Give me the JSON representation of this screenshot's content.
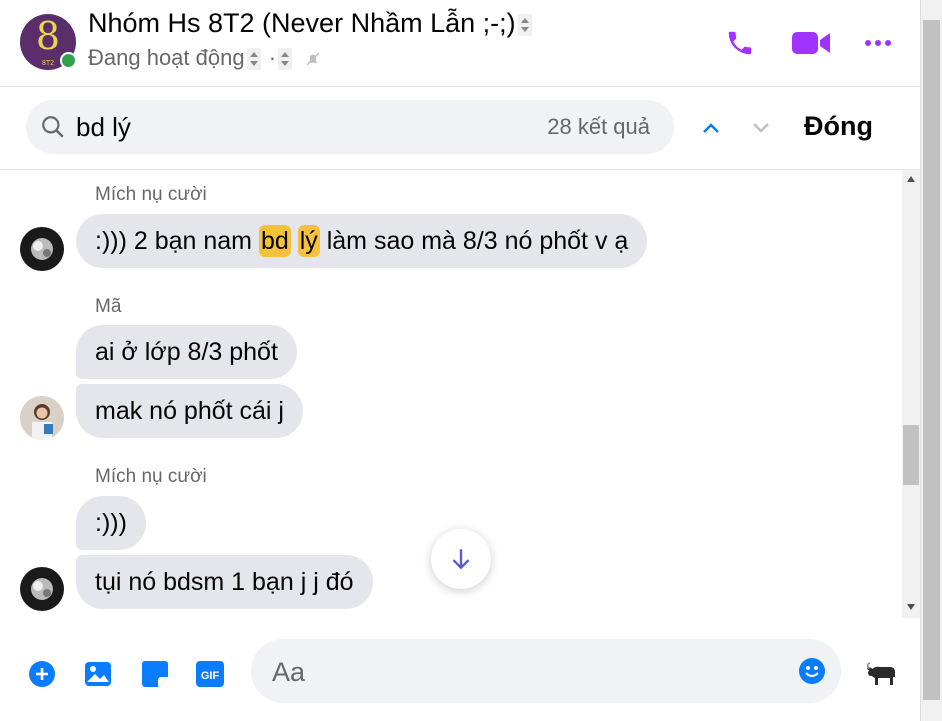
{
  "header": {
    "group_name": "Nhóm Hs 8T2 (Never Nhầm Lẫn ;-;)",
    "avatar_big": "8",
    "avatar_small": "8T2",
    "status": "Đang hoạt động",
    "status_sep": "·",
    "accent_color": "#a033ff"
  },
  "search": {
    "query": "bd lý",
    "result_count": "28 kết quả",
    "close_label": "Đóng",
    "up_color": "#0a7cff",
    "down_color": "#bcc0c4"
  },
  "messages": [
    {
      "sender": "Mích nụ cười",
      "parts": [
        ":))) 2 bạn nam ",
        "bd",
        " ",
        "lý",
        " làm sao mà 8/3 nó phốt v ạ"
      ]
    },
    {
      "sender": "Mã",
      "texts": [
        "ai ở lớp 8/3 phốt",
        "mak nó phốt cái j"
      ]
    },
    {
      "sender": "Mích nụ cười",
      "texts": [
        ":)))",
        "tụi nó bdsm 1 bạn j j đó"
      ]
    }
  ],
  "composer": {
    "placeholder": "Aa",
    "icons": [
      "plus-icon",
      "image-icon",
      "sticker-icon",
      "gif-icon",
      "emoji-icon",
      "buffalo-icon"
    ],
    "gif_label": "GIF"
  }
}
